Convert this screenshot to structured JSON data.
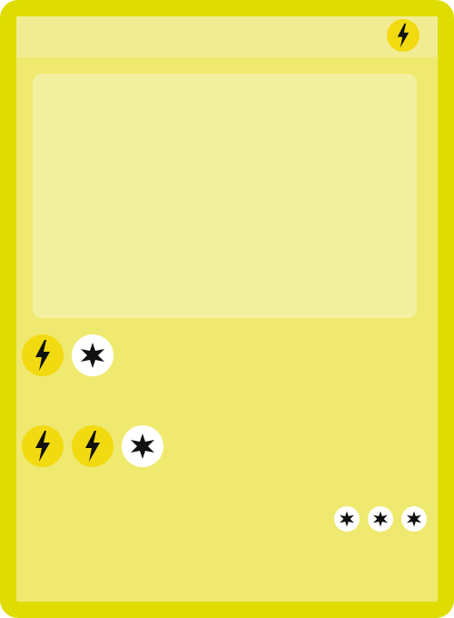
{
  "card": {
    "type_icon": "lightning-icon",
    "border_color": "#dedc00",
    "body_color": "#efe970",
    "header_color": "#f1ec92",
    "art_color": "#f3f0a0"
  },
  "attacks": [
    {
      "cost": [
        "lightning-icon",
        "colorless-star-icon"
      ]
    },
    {
      "cost": [
        "lightning-icon",
        "lightning-icon",
        "colorless-star-icon"
      ]
    }
  ],
  "retreat_cost": [
    "colorless-star-icon",
    "colorless-star-icon",
    "colorless-star-icon"
  ],
  "colors": {
    "lightning_energy": "#f2da10",
    "colorless_energy": "#ffffff",
    "symbol": "#111111"
  }
}
